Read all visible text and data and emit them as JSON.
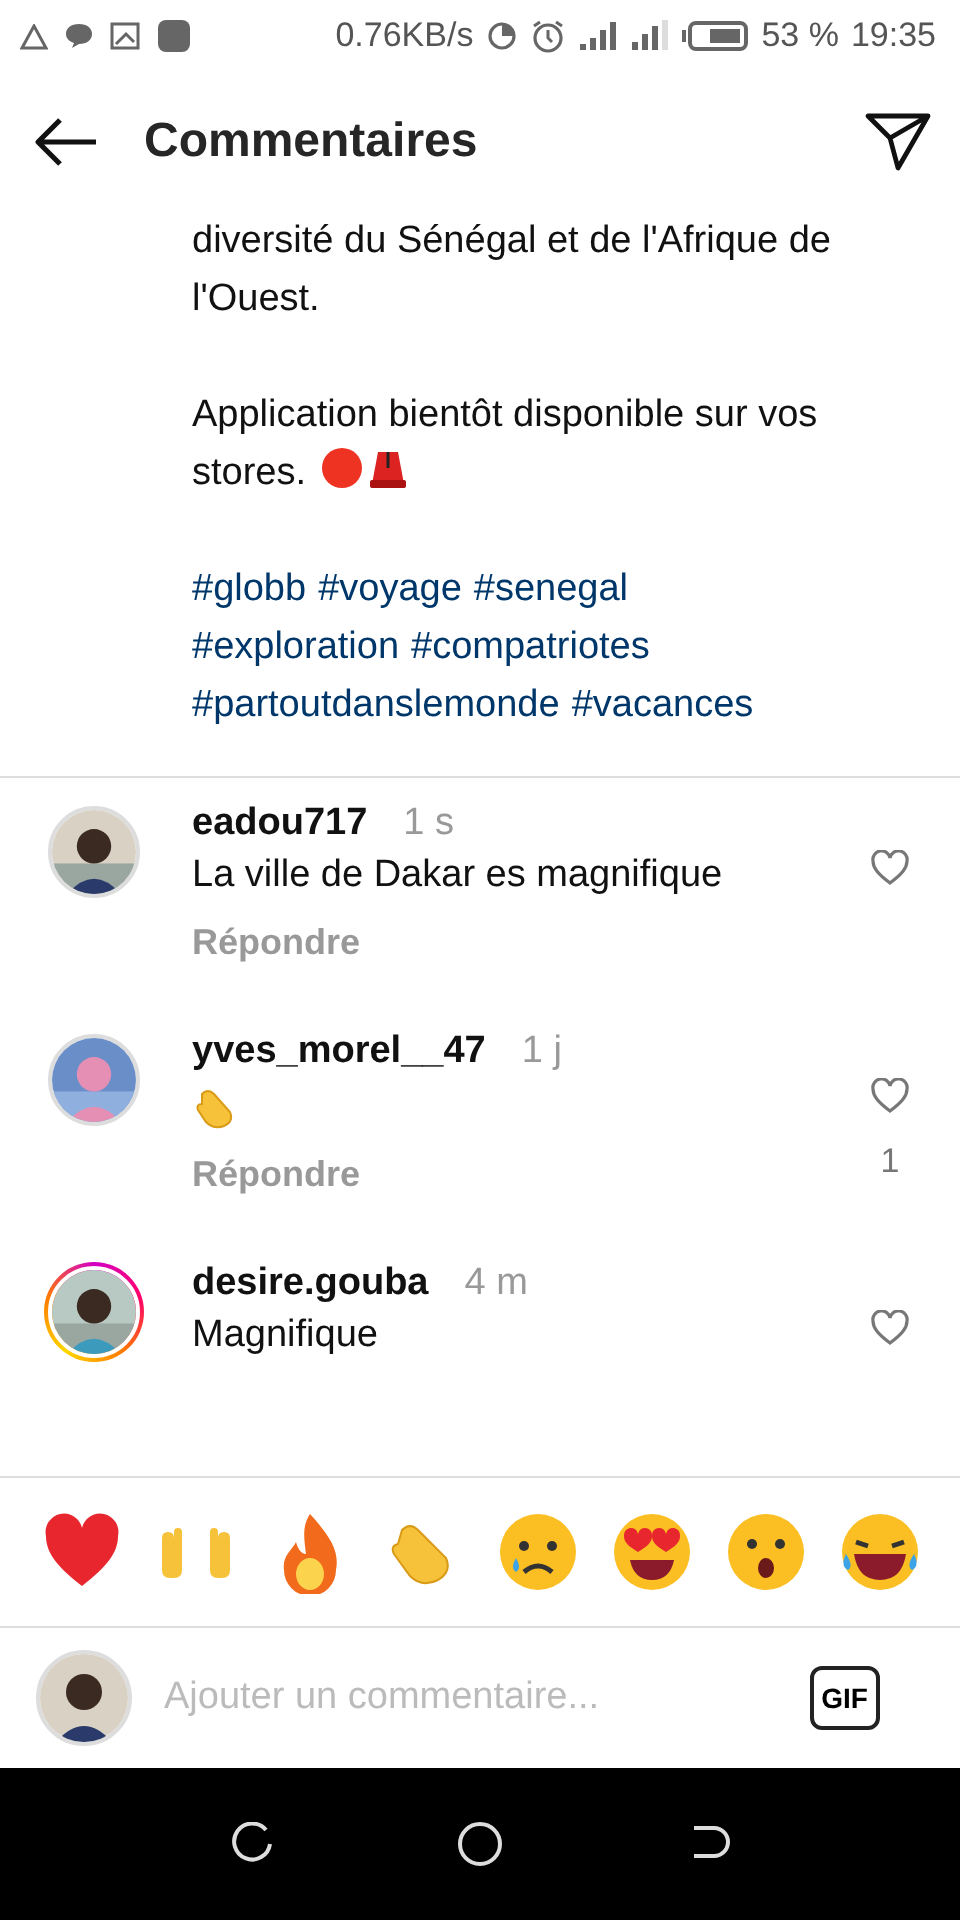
{
  "status_bar": {
    "speed": "0.76KB/s",
    "battery": "53 %",
    "time": "19:35"
  },
  "header": {
    "title": "Commentaires"
  },
  "caption": {
    "lines": [
      "diversité du Sénégal et de l'Afrique de l'Ouest."
    ],
    "line2": "Application bientôt disponible sur vos stores.",
    "hashtag_lines": [
      [
        "#globb",
        "#voyage",
        "#senegal"
      ],
      [
        "#exploration",
        "#compatriotes"
      ],
      [
        "#partoutdanslemonde",
        "#vacances"
      ]
    ]
  },
  "comments": [
    {
      "user": "eadou717",
      "time": "1 s",
      "kind": "text",
      "text": "La ville de Dakar es magnifique",
      "reply": "Répondre",
      "story_ring": false
    },
    {
      "user": "yves_morel__47",
      "time": "1 j",
      "kind": "emoji",
      "reply": "Répondre",
      "likes": "1",
      "story_ring": false
    },
    {
      "user": "desire.gouba",
      "time": "4 m",
      "kind": "text",
      "text": "Magnifique",
      "story_ring": true
    }
  ],
  "composer": {
    "placeholder": "Ajouter un commentaire...",
    "gif": "GIF"
  }
}
